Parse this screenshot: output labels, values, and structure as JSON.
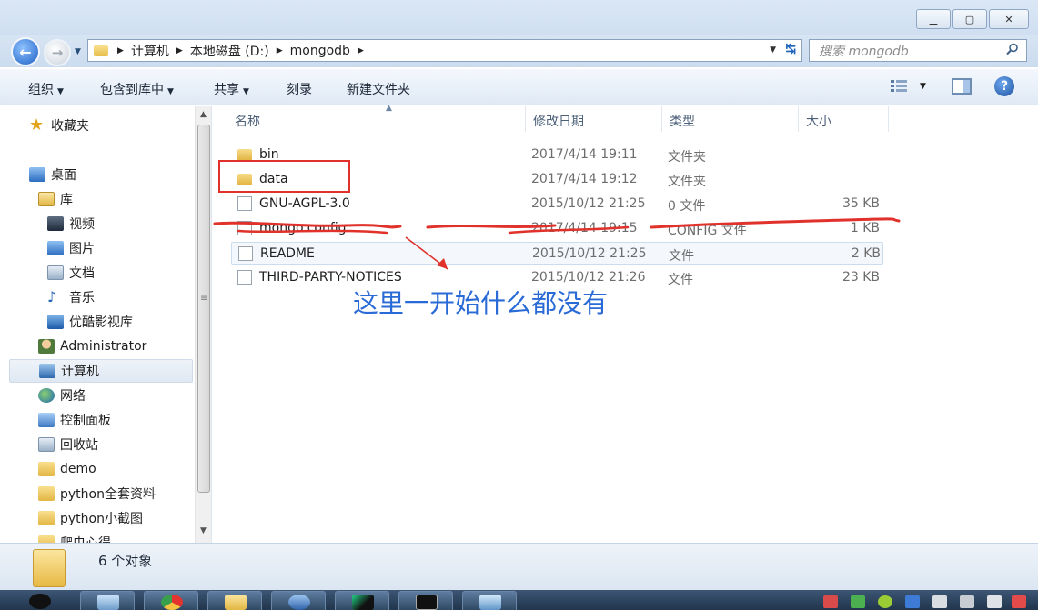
{
  "breadcrumb": [
    "计算机",
    "本地磁盘 (D:)",
    "mongodb"
  ],
  "search": {
    "placeholder": "搜索 mongodb"
  },
  "toolbar": {
    "organize": "组织",
    "include_in_library": "包含到库中",
    "share": "共享",
    "burn": "刻录",
    "new_folder": "新建文件夹"
  },
  "sidebar": {
    "favorites": "收藏夹",
    "desktop": "桌面",
    "libraries": "库",
    "videos": "视频",
    "pictures": "图片",
    "documents": "文档",
    "music": "音乐",
    "youku": "优酷影视库",
    "administrator": "Administrator",
    "computer": "计算机",
    "network": "网络",
    "control_panel": "控制面板",
    "recycle_bin": "回收站",
    "demo": "demo",
    "python_materials": "python全套资料",
    "python_screenshots": "python小截图",
    "crawler_notes": "爬虫心得"
  },
  "columns": {
    "name": "名称",
    "date": "修改日期",
    "type": "类型",
    "size": "大小"
  },
  "files": [
    {
      "name": "bin",
      "date": "2017/4/14 19:11",
      "type": "文件夹",
      "size": "",
      "kind": "folder"
    },
    {
      "name": "data",
      "date": "2017/4/14 19:12",
      "type": "文件夹",
      "size": "",
      "kind": "folder"
    },
    {
      "name": "GNU-AGPL-3.0",
      "date": "2015/10/12 21:25",
      "type": "0 文件",
      "size": "35 KB",
      "kind": "file"
    },
    {
      "name": "mongo.config",
      "date": "2017/4/14 19:15",
      "type": "CONFIG 文件",
      "size": "1 KB",
      "kind": "file"
    },
    {
      "name": "README",
      "date": "2015/10/12 21:25",
      "type": "文件",
      "size": "2 KB",
      "kind": "file"
    },
    {
      "name": "THIRD-PARTY-NOTICES",
      "date": "2015/10/12 21:26",
      "type": "文件",
      "size": "23 KB",
      "kind": "file"
    }
  ],
  "annotation": {
    "note": "这里一开始什么都没有",
    "highlight_color": "#e0312b",
    "note_color": "#2a6ad6"
  },
  "status": {
    "count": "6 个对象"
  },
  "colors": {
    "accent": "#2a6ad6",
    "titlebar": "#dbe7f5"
  }
}
